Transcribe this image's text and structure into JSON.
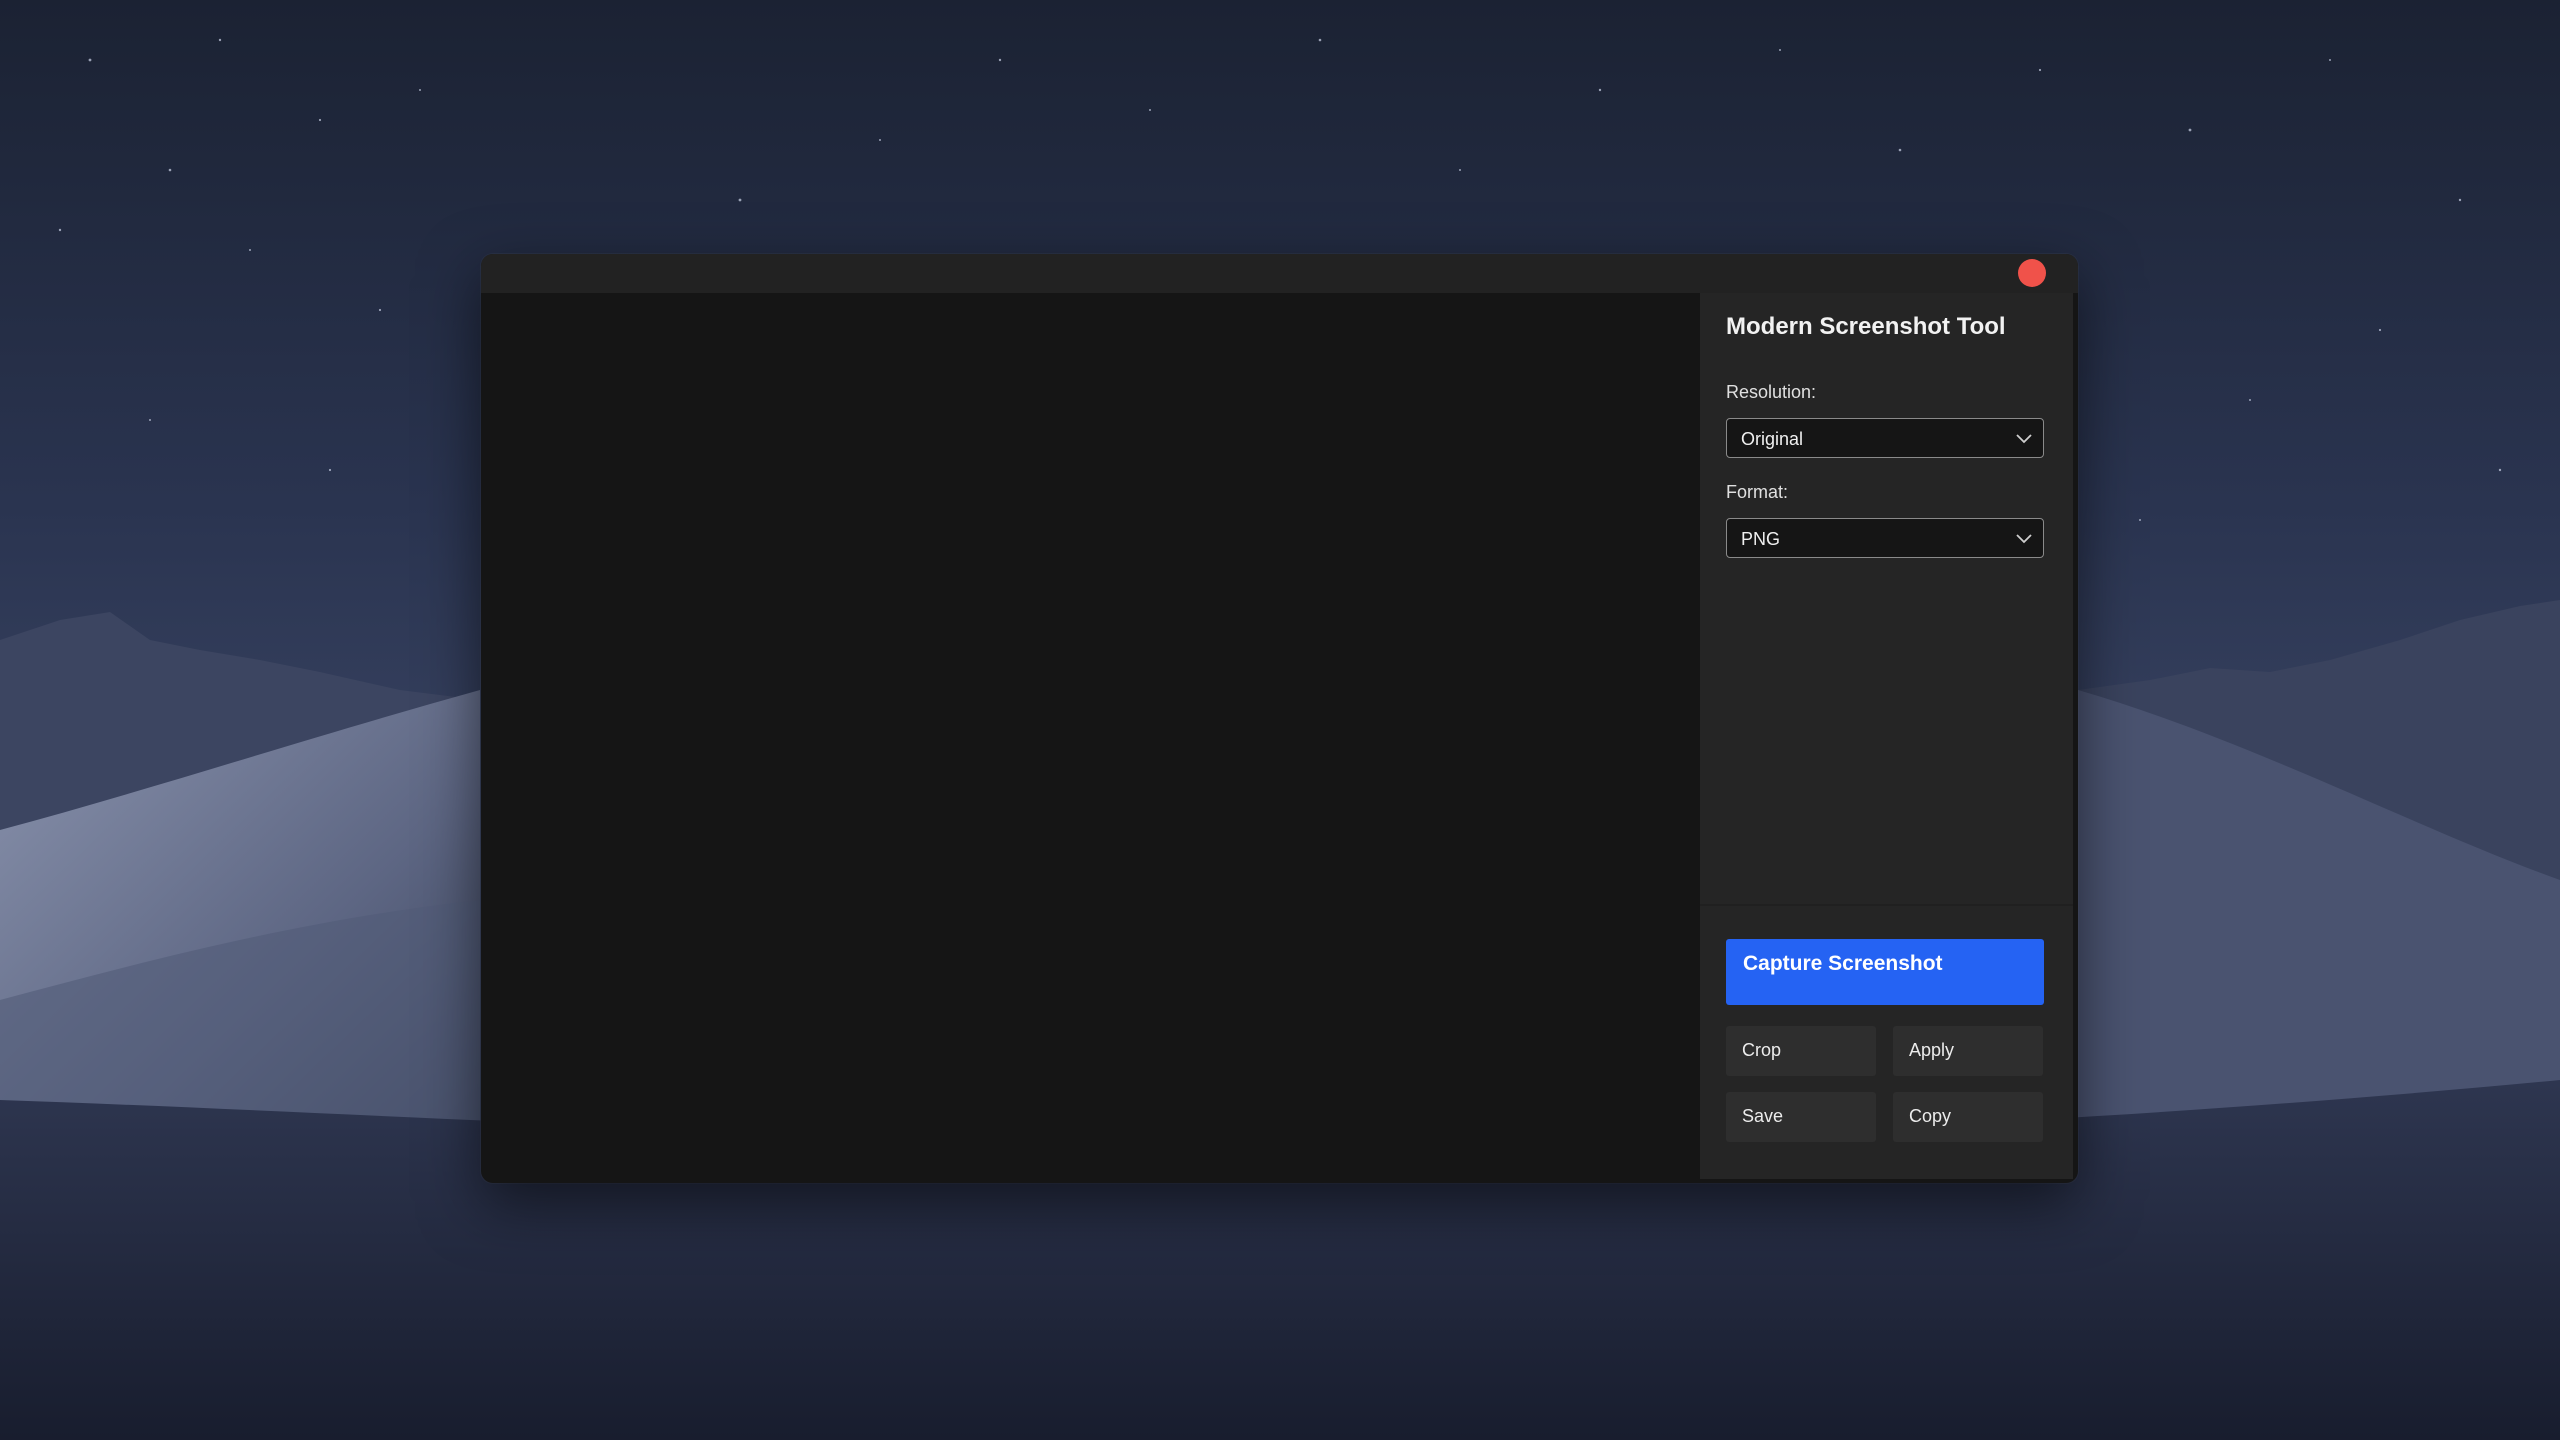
{
  "window": {
    "close_color": "#f0524a"
  },
  "panel": {
    "title": "Modern Screenshot Tool",
    "resolution": {
      "label": "Resolution:",
      "value": "Original"
    },
    "format": {
      "label": "Format:",
      "value": "PNG"
    }
  },
  "actions": {
    "capture_label": "Capture Screenshot",
    "crop_label": "Crop",
    "apply_label": "Apply",
    "save_label": "Save",
    "copy_label": "Copy"
  },
  "icons": {
    "close": "close-icon",
    "dropdown": "chevron-down-icon"
  },
  "colors": {
    "accent": "#2563f3",
    "panel_bg": "#252525",
    "preview_bg": "#151515"
  }
}
